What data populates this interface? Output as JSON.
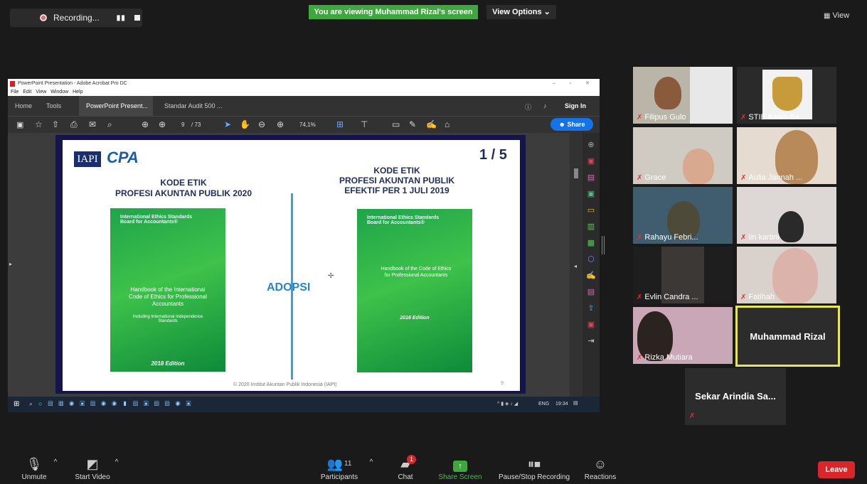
{
  "topbar": {
    "recording_label": "Recording...",
    "viewing_banner": "You are viewing Muhammad Rizal's screen",
    "view_options": "View Options",
    "view_label": "View"
  },
  "acrobat": {
    "window_title": "PowerPoint Presentation - Adobe Acrobat Pro DC",
    "menu": [
      "File",
      "Edit",
      "View",
      "Window",
      "Help"
    ],
    "tabs": [
      "Home",
      "Tools",
      "PowerPoint Present...",
      "Standar Audit 500 ..."
    ],
    "sign_in": "Sign In",
    "page_current": "9",
    "page_total": "/ 73",
    "zoom": "74,1%",
    "share_label": "Share",
    "taskbar_lang": "ENG",
    "taskbar_time": "19:34"
  },
  "slide": {
    "counter": "1 / 5",
    "logo_iapi": "IAPI",
    "logo_cpa": "CPA",
    "left_title_1": "KODE ETIK",
    "left_title_2": "PROFESI AKUNTAN PUBLIK 2020",
    "right_title_1": "KODE ETIK",
    "right_title_2": "PROFESI AKUNTAN PUBLIK",
    "right_title_3": "EFEKTIF PER 1 JULI 2019",
    "adopsi": "ADOPSI",
    "book_left_header": "International Ethics Standards Board for Accountants®",
    "book_left_title": "Handbook of the International Code of Ethics for Professional Accountants",
    "book_left_sub": "Including International Independence Standards",
    "book_left_edition": "2018 Edition",
    "book_right_header": "International Ethics Standards Board for Accountants®",
    "book_right_title": "Handbook of the Code of Ethics for Professional Accountants",
    "book_right_edition": "2016 Edition",
    "footer": "© 2020 Institut Akuntan Publik Indonesia (IAPI)",
    "page_no": "9"
  },
  "participants": [
    {
      "name": "Filipus Gulo"
    },
    {
      "name": "STIE Kasih Ba..."
    },
    {
      "name": "Grace"
    },
    {
      "name": "Aulia Jannah ..."
    },
    {
      "name": "Rahayu Febri..."
    },
    {
      "name": "iin kartini"
    },
    {
      "name": "Evlin Candra ..."
    },
    {
      "name": "Fatihah"
    },
    {
      "name": "Rizka Mutiara"
    },
    {
      "name": "Muhammad Rizal"
    },
    {
      "name": "Sekar Arindia Sa..."
    }
  ],
  "bottombar": {
    "unmute": "Unmute",
    "start_video": "Start Video",
    "participants_label": "Participants",
    "participants_count": "11",
    "chat": "Chat",
    "chat_badge": "1",
    "share_screen": "Share Screen",
    "pause_stop": "Pause/Stop Recording",
    "reactions": "Reactions",
    "leave": "Leave"
  },
  "colors": {
    "accent_green": "#3ea83e",
    "leave_red": "#d9262b",
    "active_speaker_border": "#e6e65a"
  }
}
